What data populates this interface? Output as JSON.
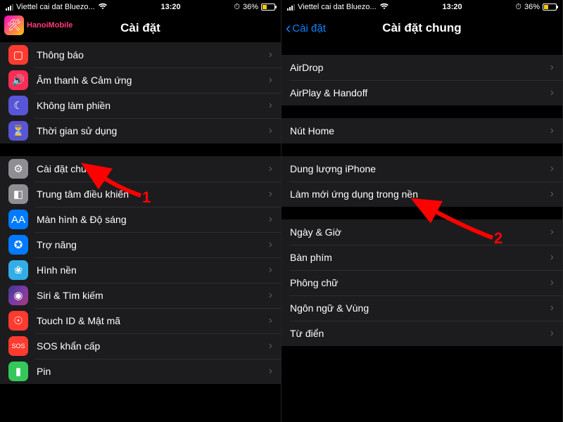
{
  "status": {
    "carrier": "Viettel cai dat Bluezo...",
    "time": "13:20",
    "battery_pct": "36%",
    "battery_icon_charging": true
  },
  "left": {
    "logo_text": "HanoiMobile",
    "title": "Cài đặt",
    "groups": [
      {
        "rows": [
          {
            "icon": "notification-icon",
            "icon_class": "ic-red-outline",
            "glyph": "▢",
            "label": "Thông báo"
          },
          {
            "icon": "sound-icon",
            "icon_class": "ic-pink",
            "glyph": "🔊",
            "label": "Âm thanh & Cảm ứng"
          },
          {
            "icon": "moon-icon",
            "icon_class": "ic-purple",
            "glyph": "☾",
            "label": "Không làm phiền"
          },
          {
            "icon": "hourglass-icon",
            "icon_class": "ic-purple",
            "glyph": "⏳",
            "label": "Thời gian sử dụng"
          }
        ]
      },
      {
        "rows": [
          {
            "icon": "gear-icon",
            "icon_class": "ic-gray",
            "glyph": "⚙",
            "label": "Cài đặt chung"
          },
          {
            "icon": "control-center-icon",
            "icon_class": "ic-gray",
            "glyph": "◧",
            "label": "Trung tâm điều khiển"
          },
          {
            "icon": "display-icon",
            "icon_class": "ic-blue",
            "glyph": "AA",
            "label": "Màn hình & Độ sáng"
          },
          {
            "icon": "accessibility-icon",
            "icon_class": "ic-blue",
            "glyph": "✪",
            "label": "Trợ năng"
          },
          {
            "icon": "wallpaper-icon",
            "icon_class": "ic-cyan",
            "glyph": "❀",
            "label": "Hình nền"
          },
          {
            "icon": "siri-icon",
            "icon_class": "ic-siri",
            "glyph": "◉",
            "label": "Siri & Tìm kiếm"
          },
          {
            "icon": "touchid-icon",
            "icon_class": "ic-red",
            "glyph": "☉",
            "label": "Touch ID & Mật mã"
          },
          {
            "icon": "sos-icon",
            "icon_class": "ic-red",
            "glyph": "SOS",
            "label": "SOS khẩn cấp"
          },
          {
            "icon": "battery-icon",
            "icon_class": "ic-green",
            "glyph": "▮",
            "label": "Pin"
          }
        ]
      }
    ]
  },
  "right": {
    "back_label": "Cài đặt",
    "title": "Cài đặt chung",
    "groups": [
      {
        "rows": [
          {
            "label": "AirDrop"
          },
          {
            "label": "AirPlay & Handoff"
          }
        ]
      },
      {
        "rows": [
          {
            "label": "Nút Home"
          }
        ]
      },
      {
        "rows": [
          {
            "label": "Dung lượng iPhone"
          },
          {
            "label": "Làm mới ứng dụng trong nền"
          }
        ]
      },
      {
        "rows": [
          {
            "label": "Ngày & Giờ"
          },
          {
            "label": "Bàn phím"
          },
          {
            "label": "Phông chữ"
          },
          {
            "label": "Ngôn ngữ & Vùng"
          },
          {
            "label": "Từ điển"
          }
        ]
      }
    ]
  },
  "annotations": {
    "arrow1_num": "1",
    "arrow2_num": "2"
  }
}
